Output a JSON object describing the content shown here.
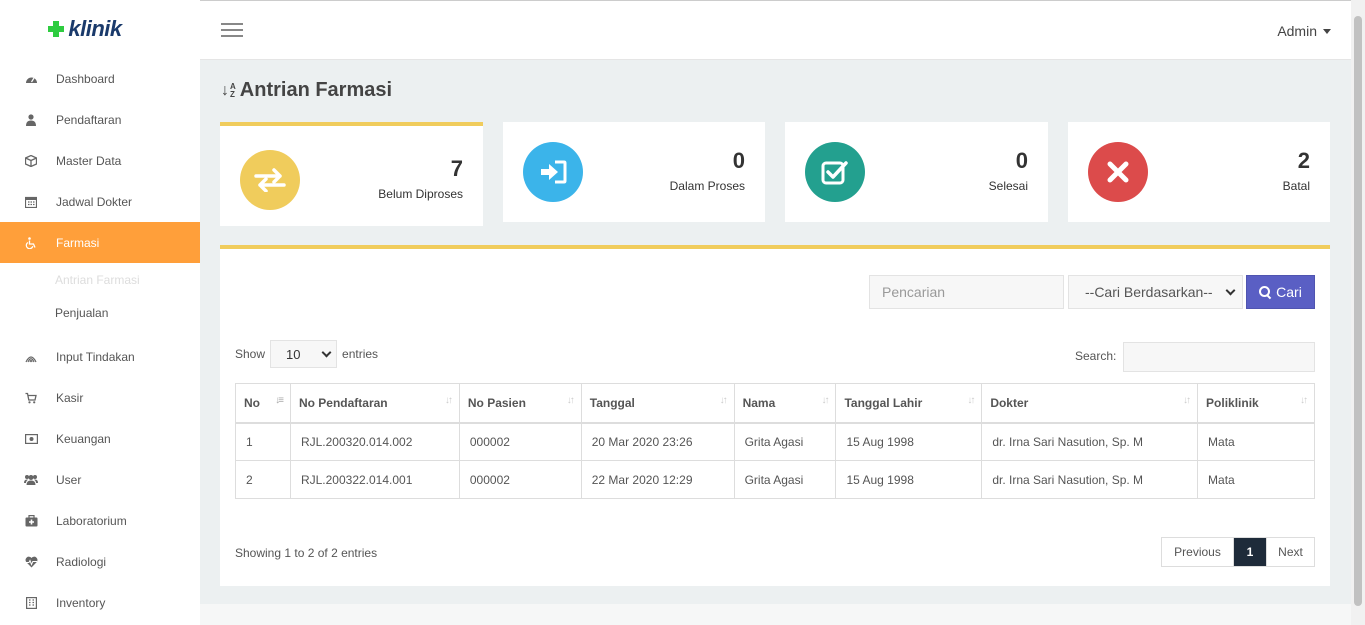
{
  "brand": {
    "name": "klinik"
  },
  "sidebar": {
    "items": [
      {
        "label": "Dashboard",
        "icon": "dashboard-icon"
      },
      {
        "label": "Pendaftaran",
        "icon": "user-icon"
      },
      {
        "label": "Master Data",
        "icon": "cube-icon"
      },
      {
        "label": "Jadwal Dokter",
        "icon": "calendar-icon"
      },
      {
        "label": "Farmasi",
        "icon": "wheelchair-icon",
        "active": true
      },
      {
        "label": "Input Tindakan",
        "icon": "stethoscope-icon"
      },
      {
        "label": "Kasir",
        "icon": "cart-icon"
      },
      {
        "label": "Keuangan",
        "icon": "money-icon"
      },
      {
        "label": "User",
        "icon": "users-icon"
      },
      {
        "label": "Laboratorium",
        "icon": "medkit-icon"
      },
      {
        "label": "Radiologi",
        "icon": "heartbeat-icon"
      },
      {
        "label": "Inventory",
        "icon": "building-icon"
      }
    ],
    "farmasi_sub": [
      {
        "label": "Antrian Farmasi",
        "current": true
      },
      {
        "label": "Penjualan"
      }
    ]
  },
  "topbar": {
    "user": "Admin"
  },
  "page": {
    "title": "Antrian Farmasi"
  },
  "stats": [
    {
      "value": "7",
      "label": "Belum Diproses",
      "color": "#f0cc5c",
      "icon": "exchange-icon"
    },
    {
      "value": "0",
      "label": "Dalam Proses",
      "color": "#3bb4ea",
      "icon": "sign-in-icon"
    },
    {
      "value": "0",
      "label": "Selesai",
      "color": "#23a08f",
      "icon": "check-square-icon"
    },
    {
      "value": "2",
      "label": "Batal",
      "color": "#dc4b4b",
      "icon": "times-icon"
    }
  ],
  "filter": {
    "placeholder": "Pencarian",
    "select_value": "--Cari Berdasarkan--",
    "button": "Cari"
  },
  "table_controls": {
    "show": "Show",
    "entries_value": "10",
    "entries": "entries",
    "search_label": "Search:"
  },
  "table": {
    "columns": [
      "No",
      "No Pendaftaran",
      "No Pasien",
      "Tanggal",
      "Nama",
      "Tanggal Lahir",
      "Dokter",
      "Poliklinik"
    ],
    "rows": [
      [
        "1",
        "RJL.200320.014.002",
        "000002",
        "20 Mar 2020 23:26",
        "Grita Agasi",
        "15 Aug 1998",
        "dr. Irna Sari Nasution, Sp. M",
        "Mata"
      ],
      [
        "2",
        "RJL.200322.014.001",
        "000002",
        "22 Mar 2020 12:29",
        "Grita Agasi",
        "15 Aug 1998",
        "dr. Irna Sari Nasution, Sp. M",
        "Mata"
      ]
    ]
  },
  "footer": {
    "info": "Showing 1 to 2 of 2 entries",
    "prev": "Previous",
    "page": "1",
    "next": "Next"
  },
  "colors": {
    "accent": "#ff9f3a",
    "panel_top": "#f0cc5c",
    "primary_btn": "#5a5fc4",
    "pager_active": "#1e2b3a"
  }
}
